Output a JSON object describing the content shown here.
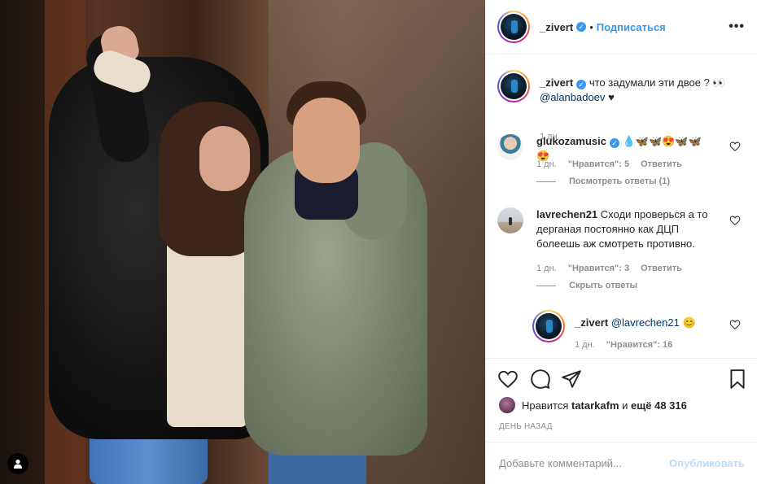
{
  "post": {
    "author": {
      "username": "_zivert",
      "verified_icon": "verified-badge-icon",
      "separator": "•",
      "follow_label": "Подписаться",
      "more_icon": "•••"
    },
    "caption": {
      "username": "_zivert",
      "text": " что задумали эти двое ? 👀 ",
      "mention": "@alanbadoev",
      "heart": "♥",
      "time": "1 дн."
    },
    "comments": [
      {
        "username": "glukozamusic",
        "verified": true,
        "text": "💧🦋🦋😍🦋🦋😍",
        "time": "1 дн.",
        "likes_label": "\"Нравится\": 5",
        "reply_label": "Ответить",
        "replies_toggle": "Посмотреть ответы (1)"
      },
      {
        "username": "lavrechen21",
        "verified": false,
        "text": "Сходи проверься а то дерганая постоянно как ДЦП болеешь аж смотреть противно.",
        "time": "1 дн.",
        "likes_label": "\"Нравится\": 3",
        "reply_label": "Ответить",
        "replies_toggle": "Скрыть ответы"
      }
    ],
    "reply": {
      "username": "_zivert",
      "mention": "@lavrechen21",
      "emoji": "😊",
      "time": "1 дн.",
      "likes_label": "\"Нравится\": 16"
    },
    "likes": {
      "prefix": "Нравится",
      "user": "tatarkafm",
      "middle": "и",
      "others": "ещё 48 316"
    },
    "date": "ДЕНЬ НАЗАД",
    "add_comment": {
      "placeholder": "Добавьте комментарий...",
      "post_label": "Опубликовать"
    }
  },
  "colors": {
    "accent": "#3897f0",
    "text": "#262626",
    "muted": "#8e8e8e",
    "border": "#efefef"
  }
}
